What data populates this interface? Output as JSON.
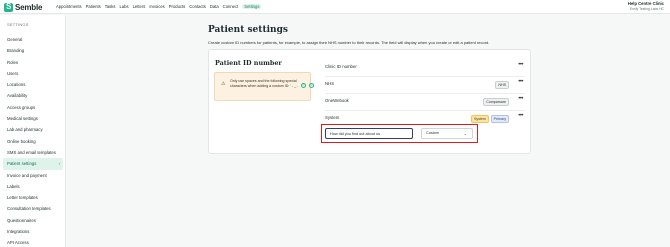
{
  "app": {
    "logo_text": "Semble"
  },
  "nav": {
    "items": [
      "Appointments",
      "Patients",
      "Tasks",
      "Labs",
      "Letters",
      "Invoices",
      "Products",
      "Contacts",
      "Data",
      "Connect",
      "Settings"
    ],
    "active": "Settings"
  },
  "account": {
    "clinic": "Help Centre Clinic",
    "sub": "Emily Testing Labs HC"
  },
  "sidebar": {
    "heading": "SETTINGS",
    "items": [
      "General",
      "Branding",
      "Roles",
      "Users",
      "Locations",
      "Availability",
      "Access groups",
      "Medical settings",
      "Lab and pharmacy",
      "Online booking",
      "SMS and email templates",
      "Patient settings",
      "Invoice and payment",
      "Labels",
      "Letter templates",
      "Consultation templates",
      "Questionnaires",
      "Integrations",
      "API Access"
    ],
    "active_chevron": "›"
  },
  "main": {
    "title": "Patient settings",
    "description": "Create custom ID numbers for patients, for example, to assign their NHS number to their records. The field will display when you create or edit a patient record."
  },
  "card": {
    "title": "Patient ID number",
    "warning": {
      "icon": "⚠",
      "text": "Only use spaces and the following special characters when adding a custom ID: ' - _ ."
    },
    "rows": [
      {
        "label": "Clinic ID number",
        "tags": []
      },
      {
        "label": "NHS",
        "tags": [
          "NHS"
        ]
      },
      {
        "label": "OneWebook",
        "tags": [
          "Comparsare"
        ]
      },
      {
        "label": "System",
        "tags": [
          "System",
          "Primary"
        ]
      }
    ],
    "more_icon": "•••",
    "edit": {
      "name_value": "How did you find out about us",
      "type_value": "Custom",
      "chevron": "⌄",
      "ok_glyph": "✓",
      "cancel_glyph": "×"
    }
  }
}
